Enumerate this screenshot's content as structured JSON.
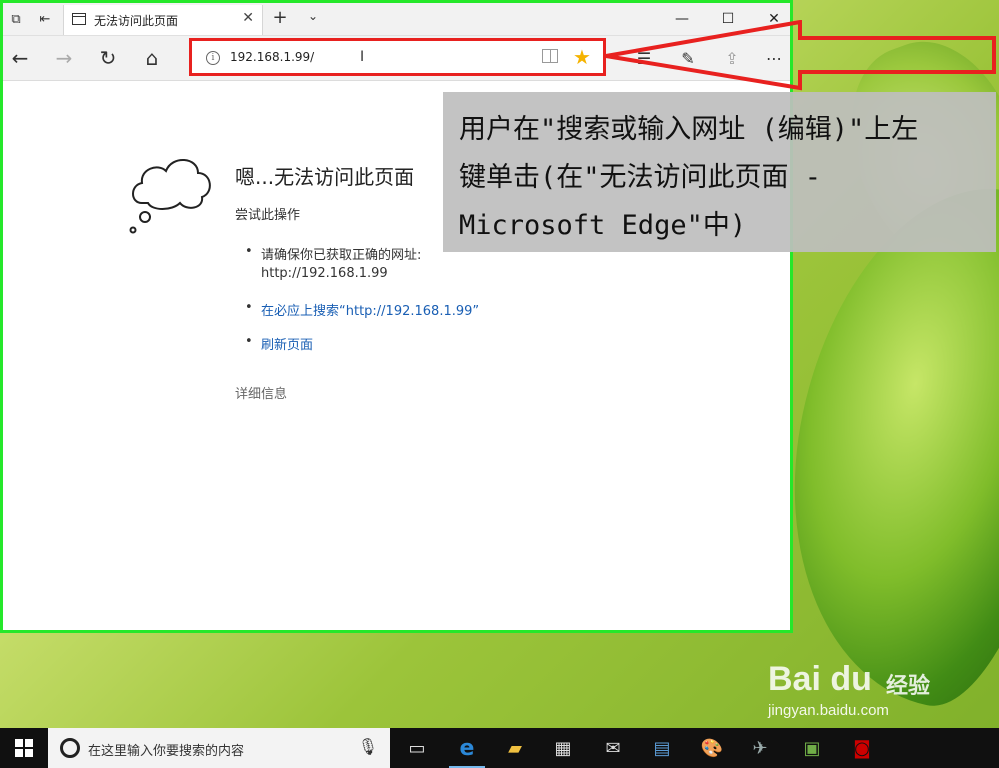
{
  "browser": {
    "tab_title": "无法访问此页面",
    "url": "192.168.1.99/",
    "new_tab_label": "+",
    "window_controls": [
      "minimize",
      "maximize",
      "close"
    ]
  },
  "error_page": {
    "title": "嗯...无法访问此页面",
    "subtitle": "尝试此操作",
    "bullet1_line1": "请确保你已获取正确的网址:",
    "bullet1_line2": "http://192.168.1.99",
    "bullet2_link": "在必应上搜索“http://192.168.1.99”",
    "bullet3_link": "刷新页面",
    "details": "详细信息"
  },
  "callout": {
    "line1": "用户在\"搜索或输入网址 (编辑)\"上左",
    "line2": "键单击(在\"无法访问此页面 -",
    "line3": "Microsoft Edge\"中)"
  },
  "watermark": {
    "brand": "Bai du",
    "jingyan": "经验",
    "url": "jingyan.baidu.com"
  },
  "taskbar": {
    "search_placeholder": "在这里输入你要搜索的内容",
    "apps": [
      "task-view",
      "edge",
      "file-explorer",
      "store",
      "mail",
      "app-6",
      "app-7",
      "app-8",
      "app-9"
    ]
  },
  "colors": {
    "highlight_border": "#e8211f",
    "window_border": "#25e82a",
    "link": "#1a5fb4",
    "favorite_star": "#f5b300"
  }
}
